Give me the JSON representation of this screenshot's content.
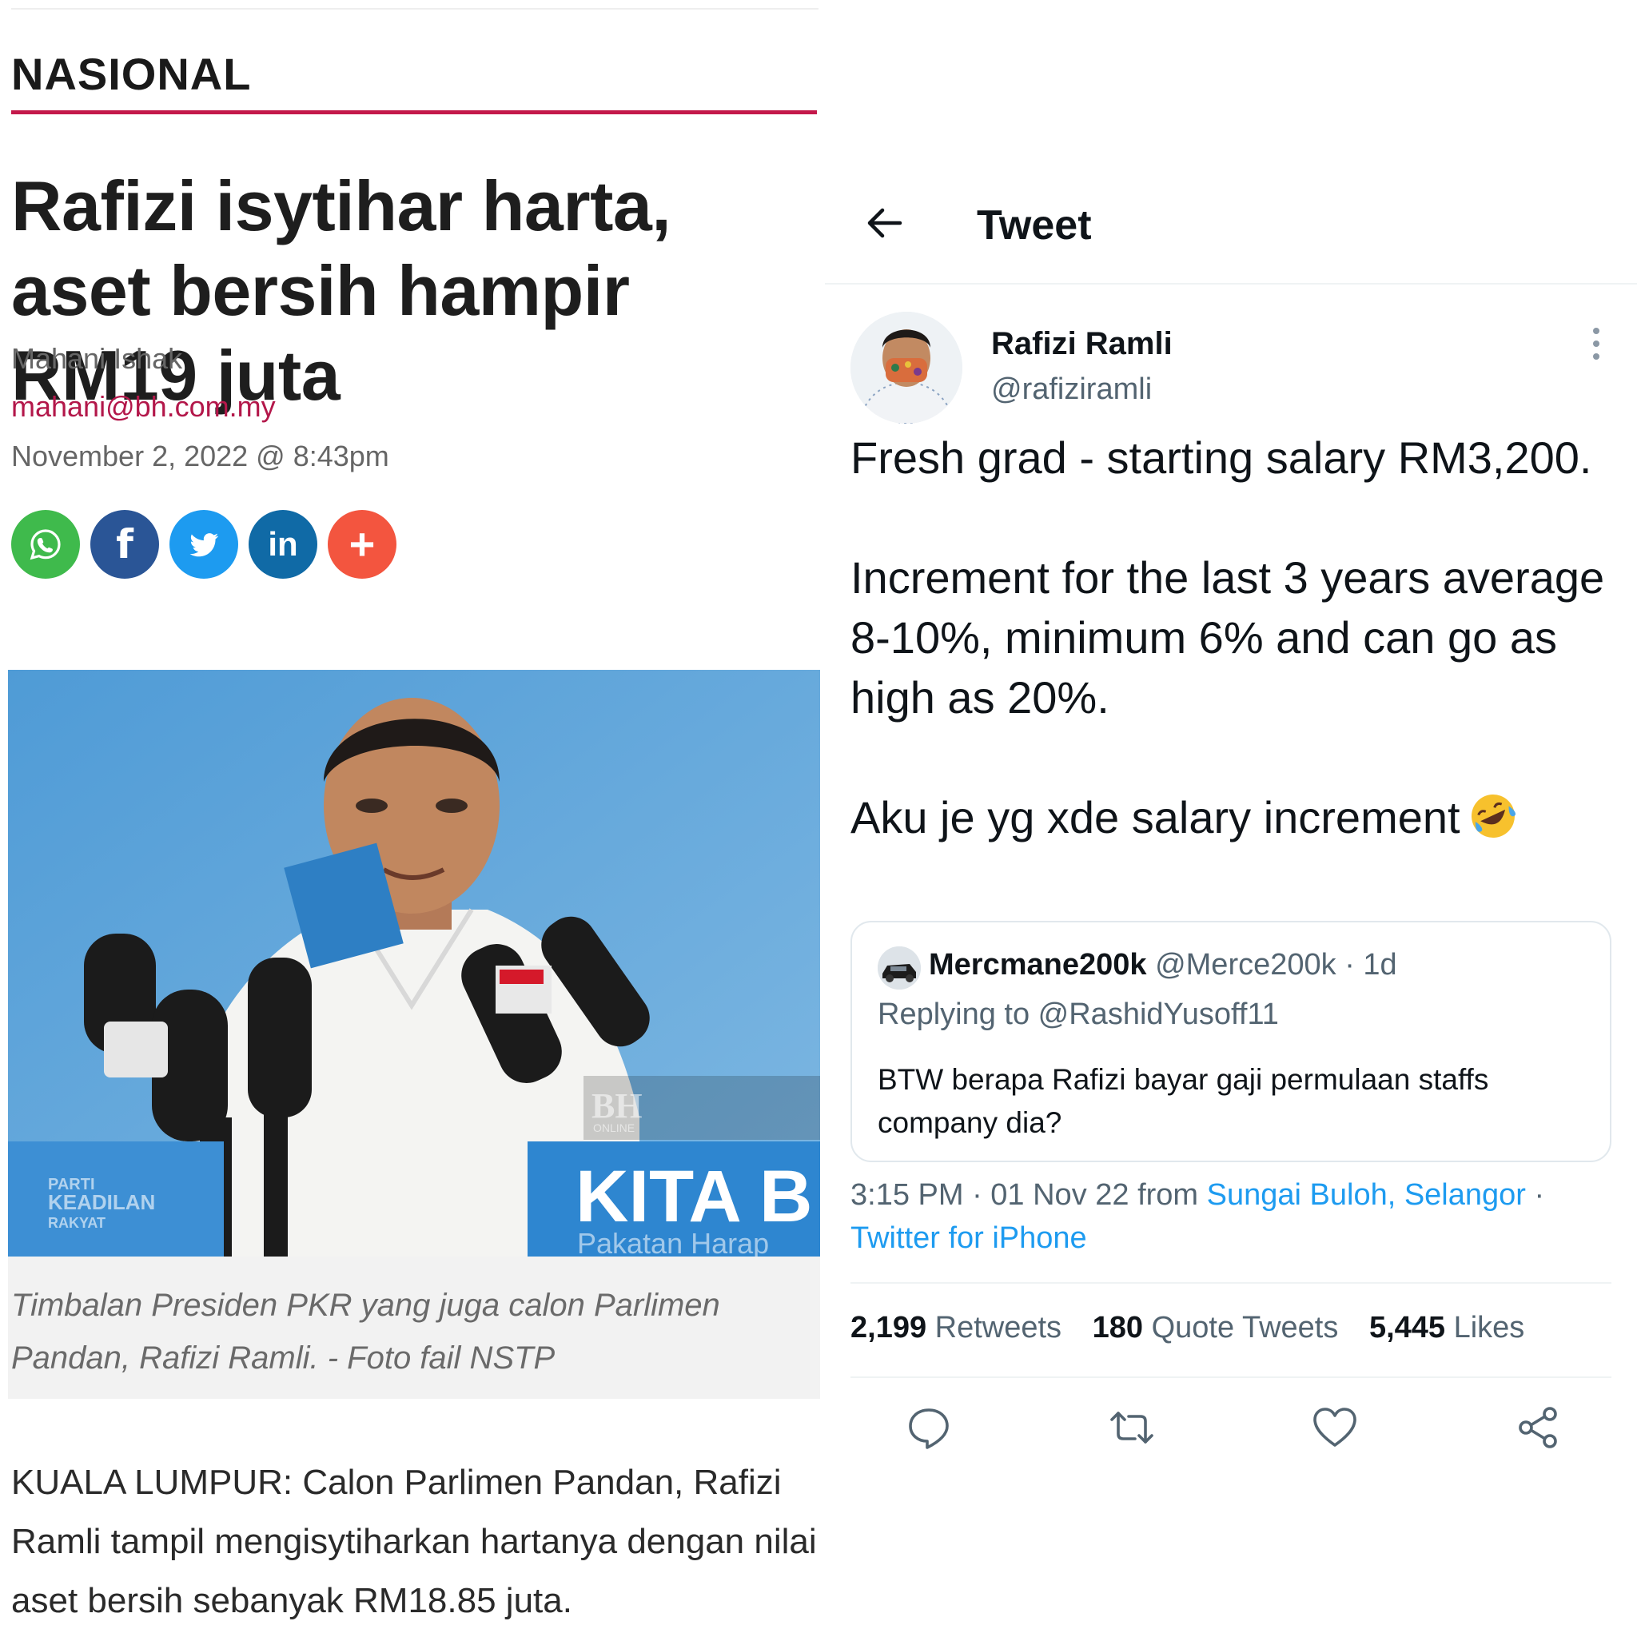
{
  "article": {
    "section": "NASIONAL",
    "headline": "Rafizi isytihar harta, aset bersih hampir RM19 juta",
    "author": "Mahani Ishak",
    "email": "mahani@bh.com.my",
    "date": "November 2, 2022 @ 8:43pm",
    "share_buttons": [
      {
        "icon": "whatsapp-icon",
        "color": "#3fba4c"
      },
      {
        "icon": "facebook-icon",
        "color": "#2a5596",
        "glyph": "f"
      },
      {
        "icon": "twitter-icon",
        "color": "#1d9bf0"
      },
      {
        "icon": "linkedin-icon",
        "color": "#106aa6",
        "glyph": "in"
      },
      {
        "icon": "plus-icon",
        "color": "#f3553f",
        "glyph": "+"
      }
    ],
    "photo": {
      "watermark": "BH",
      "watermark_sub": "ONLINE",
      "banner_left_line1": "PARTI",
      "banner_left_line2": "KEADILAN",
      "banner_left_line3": "RAKYAT",
      "banner_right_main": "KITA B",
      "banner_right_sub": "Pakatan Harap"
    },
    "caption": "Timbalan Presiden PKR yang juga calon Parlimen Pandan, Rafizi Ramli. - Foto fail NSTP",
    "body": "KUALA LUMPUR: Calon Parlimen Pandan, Rafizi Ramli tampil mengisytiharkan hartanya dengan nilai aset bersih sebanyak RM18.85 juta."
  },
  "tweet": {
    "title": "Tweet",
    "name": "Rafizi Ramli",
    "handle": "@rafiziramli",
    "text": "Fresh grad - starting salary RM3,200.\n\nIncrement for the last 3 years average 8-10%, minimum 6% and can go as high as 20%.\n\nAku je yg xde salary increment",
    "emoji": "rolling-on-floor-laughing-emoji",
    "quote": {
      "name": "Mercmane200k",
      "handle": "@Merce200k",
      "age": "· 1d",
      "replying": "Replying to @RashidYusoff11",
      "text": "BTW berapa Rafizi bayar gaji permulaan staffs company dia?"
    },
    "time": "3:15 PM · 01 Nov 22 from ",
    "location": "Sungai Buloh, Selangor",
    "sep": " · ",
    "client": "Twitter for iPhone",
    "retweets": "2,199",
    "retweets_label": "Retweets",
    "quote_tweets": "180",
    "quote_tweets_label": "Quote Tweets",
    "likes": "5,445",
    "likes_label": "Likes",
    "colors": {
      "link": "#1d9bf0",
      "muted": "#536471",
      "text": "#0f1419"
    }
  }
}
